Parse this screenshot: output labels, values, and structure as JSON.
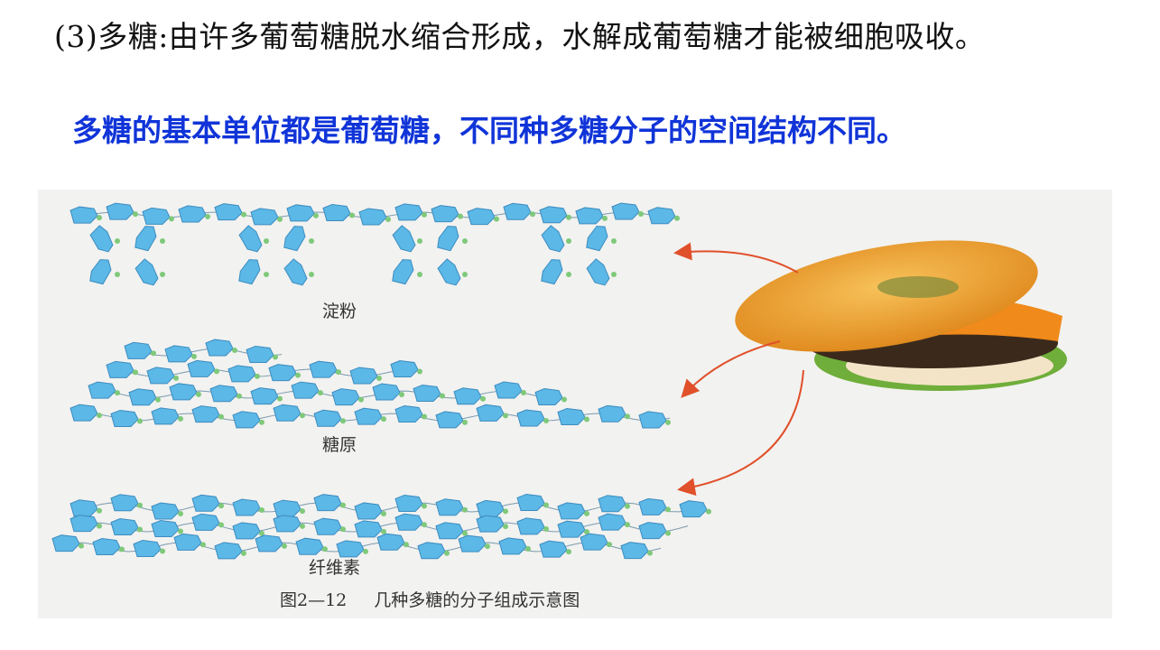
{
  "heading": "(3)多糖:由许多葡萄糖脱水缩合形成，水解成葡萄糖才能被细胞吸收。",
  "highlight": "多糖的基本单位都是葡萄糖，不同种多糖分子的空间结构不同。",
  "figure": {
    "labels": {
      "starch": "淀粉",
      "glycogen": "糖原",
      "cellulose": "纤维素"
    },
    "caption": "图2—12 几种多糖的分子组成示意图"
  },
  "colors": {
    "heading": "#111111",
    "highlight": "#1034d8",
    "glucose": "#5cb8e6",
    "arrow": "#e0502a"
  }
}
